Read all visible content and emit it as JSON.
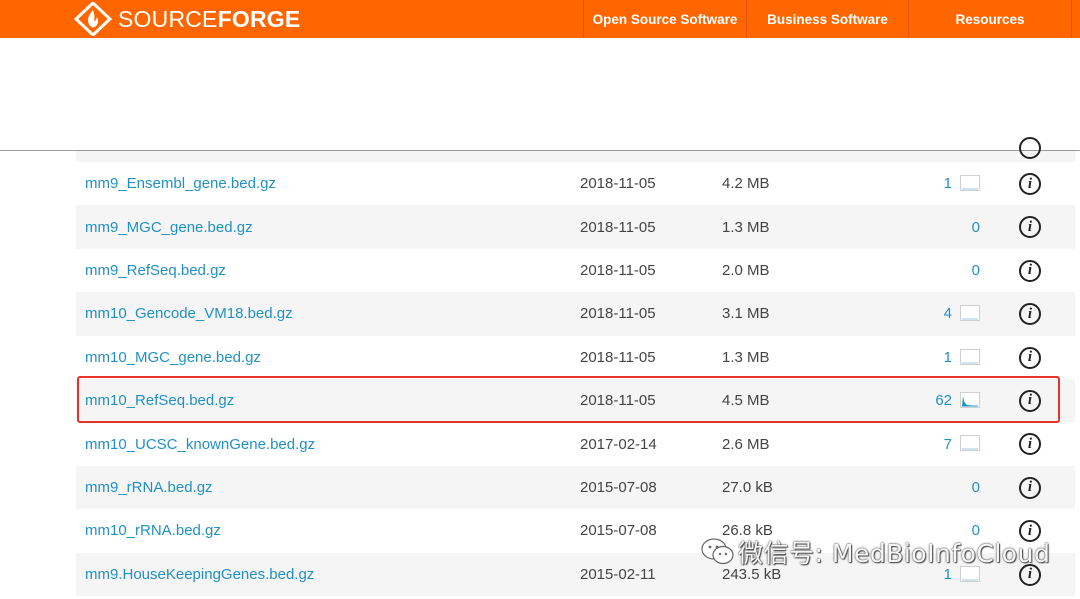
{
  "header": {
    "logo_light": "SOURCE",
    "logo_bold": "FORGE",
    "nav": [
      "Open Source Software",
      "Business Software",
      "Resources"
    ],
    "accent_color": "#ff6600"
  },
  "files": [
    {
      "name": "mm9_Ensembl_gene.bed.gz",
      "date": "2018-11-05",
      "size": "4.2 MB",
      "downloads": "1",
      "sparkline": true
    },
    {
      "name": "mm9_MGC_gene.bed.gz",
      "date": "2018-11-05",
      "size": "1.3 MB",
      "downloads": "0",
      "sparkline": false
    },
    {
      "name": "mm9_RefSeq.bed.gz",
      "date": "2018-11-05",
      "size": "2.0 MB",
      "downloads": "0",
      "sparkline": false
    },
    {
      "name": "mm10_Gencode_VM18.bed.gz",
      "date": "2018-11-05",
      "size": "3.1 MB",
      "downloads": "4",
      "sparkline": true
    },
    {
      "name": "mm10_MGC_gene.bed.gz",
      "date": "2018-11-05",
      "size": "1.3 MB",
      "downloads": "1",
      "sparkline": true
    },
    {
      "name": "mm10_RefSeq.bed.gz",
      "date": "2018-11-05",
      "size": "4.5 MB",
      "downloads": "62",
      "sparkline": true,
      "highlighted": true
    },
    {
      "name": "mm10_UCSC_knownGene.bed.gz",
      "date": "2017-02-14",
      "size": "2.6 MB",
      "downloads": "7",
      "sparkline": true
    },
    {
      "name": "mm9_rRNA.bed.gz",
      "date": "2015-07-08",
      "size": "27.0 kB",
      "downloads": "0",
      "sparkline": false
    },
    {
      "name": "mm10_rRNA.bed.gz",
      "date": "2015-07-08",
      "size": "26.8 kB",
      "downloads": "0",
      "sparkline": false
    },
    {
      "name": "mm9.HouseKeepingGenes.bed.gz",
      "date": "2015-02-11",
      "size": "243.5 kB",
      "downloads": "1",
      "sparkline": true
    }
  ],
  "info_icon": "info-icon",
  "highlight_color": "#e8322e",
  "watermark": {
    "text": "微信号: MedBioInfoCloud"
  }
}
